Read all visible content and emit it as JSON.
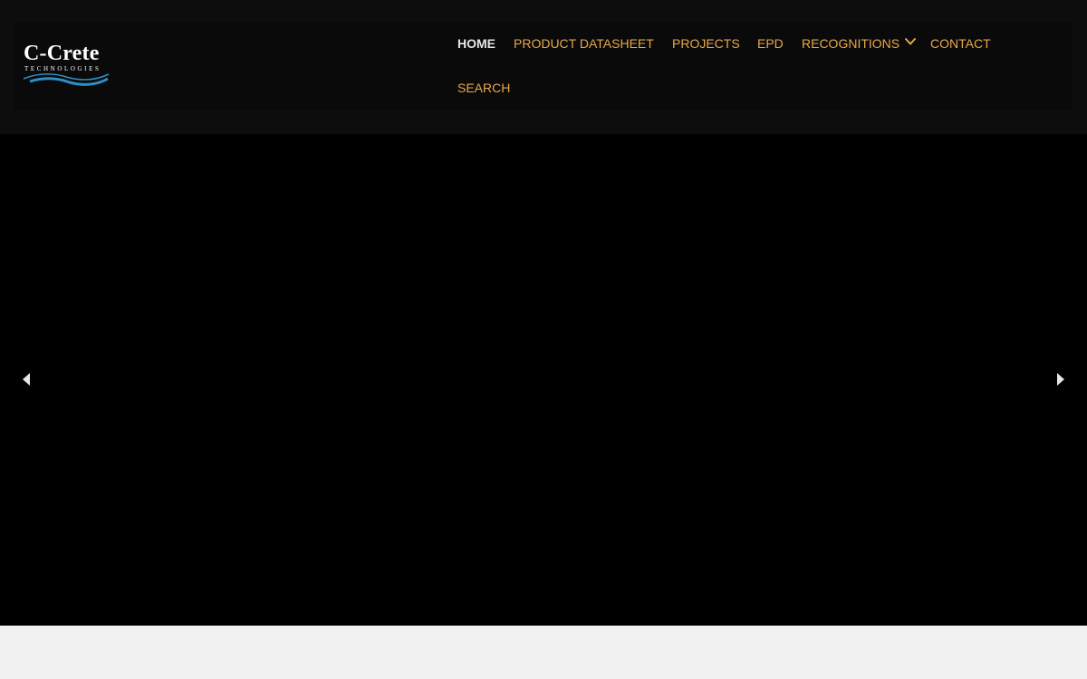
{
  "brand": {
    "name": "C-Crete",
    "tagline": "TECHNOLOGIES",
    "wave_color": "#2e8fc7"
  },
  "nav": {
    "items": [
      {
        "label": "HOME",
        "active": true
      },
      {
        "label": "PRODUCT DATASHEET"
      },
      {
        "label": "PROJECTS"
      },
      {
        "label": "EPD"
      },
      {
        "label": "RECOGNITIONS",
        "has_dropdown": true
      },
      {
        "label": "CONTACT"
      },
      {
        "label": "SEARCH"
      }
    ],
    "link_color": "#e8a84a",
    "active_color": "#e6e6e6"
  },
  "slider": {
    "prev_icon": "caret-left-icon",
    "next_icon": "caret-right-icon"
  }
}
